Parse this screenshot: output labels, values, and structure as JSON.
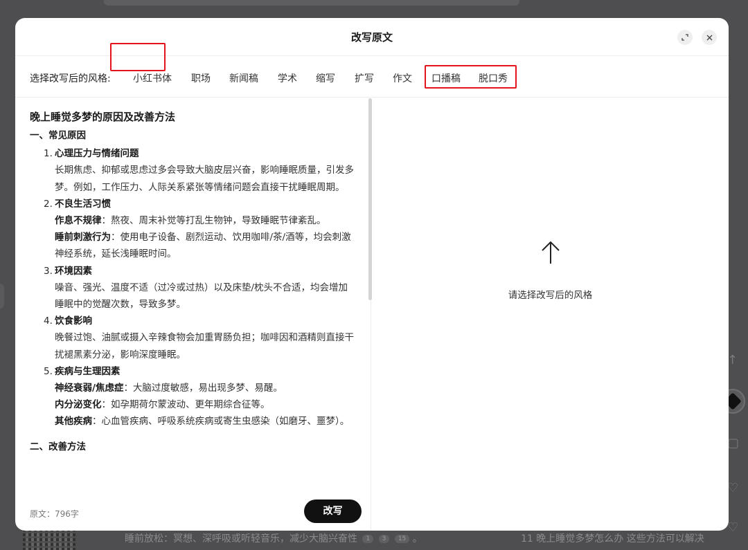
{
  "modal": {
    "title": "改写原文"
  },
  "style_bar": {
    "label": "选择改写后的风格:",
    "options": [
      "小红书体",
      "职场",
      "新闻稿",
      "学术",
      "缩写",
      "扩写",
      "作文",
      "口播稿",
      "脱口秀"
    ]
  },
  "document": {
    "title": "晚上睡觉多梦的原因及改善方法",
    "section1": "一、常见原因",
    "items": [
      {
        "num": "1.",
        "title": "心理压力与情绪问题",
        "lines": [
          "长期焦虑、抑郁或思虑过多会导致大脑皮层兴奋，影响睡眠质量，引发多梦。例如，工作压力、人际关系紧张等情绪问题会直接干扰睡眠周期。"
        ]
      },
      {
        "num": "2.",
        "title": "不良生活习惯",
        "subs": [
          {
            "bold": "作息不规律",
            "text": "：熬夜、周末补觉等打乱生物钟，导致睡眠节律紊乱。"
          },
          {
            "bold": "睡前刺激行为",
            "text": "：使用电子设备、剧烈运动、饮用咖啡/茶/酒等，均会刺激神经系统，延长浅睡眠时间。"
          }
        ]
      },
      {
        "num": "3.",
        "title": "环境因素",
        "lines": [
          "噪音、强光、温度不适（过冷或过热）以及床垫/枕头不合适，均会增加睡眠中的觉醒次数，导致多梦。"
        ]
      },
      {
        "num": "4.",
        "title": "饮食影响",
        "lines": [
          "晚餐过饱、油腻或摄入辛辣食物会加重胃肠负担；咖啡因和酒精则直接干扰褪黑素分泌，影响深度睡眠。"
        ]
      },
      {
        "num": "5.",
        "title": "疾病与生理因素",
        "subs": [
          {
            "bold": "神经衰弱/焦虑症",
            "text": "：大脑过度敏感，易出现多梦、易醒。"
          },
          {
            "bold": "内分泌变化",
            "text": "：如孕期荷尔蒙波动、更年期综合征等。"
          },
          {
            "bold": "其他疾病",
            "text": "：心血管疾病、呼吸系统疾病或寄生虫感染（如磨牙、噩梦）。"
          }
        ]
      }
    ],
    "section2": "二、改善方法"
  },
  "footer": {
    "char_count": "原文：796字",
    "rewrite_label": "改写"
  },
  "right": {
    "hint": "请选择改写后的风格"
  },
  "background": {
    "left_line": "睡前放松：冥想、深呼吸或听轻音乐，减少大脑兴奋性",
    "cites": [
      "1",
      "3",
      "15"
    ],
    "right_line": "11 晚上睡觉多梦怎么办 这些方法可以解决"
  },
  "icons": {
    "expand": "expand-icon",
    "close": "close-icon",
    "arrow": "arrow-up-icon"
  },
  "colors": {
    "highlight": "#e3121b",
    "button": "#111111"
  }
}
